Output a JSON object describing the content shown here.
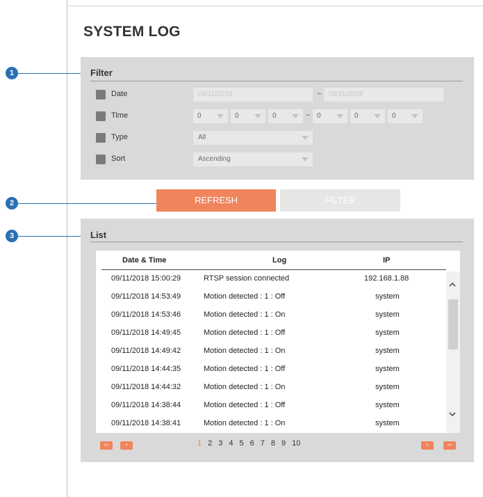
{
  "title": "SYSTEM LOG",
  "callouts": [
    "1",
    "2",
    "3"
  ],
  "filter": {
    "heading": "Filter",
    "date": {
      "label": "Date",
      "from": "09/11/2018",
      "to": "09/11/2018",
      "sep": "~"
    },
    "time": {
      "label": "Time",
      "from": [
        "0",
        "0",
        "0"
      ],
      "to": [
        "0",
        "0",
        "0"
      ],
      "sep": "~"
    },
    "type": {
      "label": "Type",
      "value": "All"
    },
    "sort": {
      "label": "Sort",
      "value": "Ascending"
    }
  },
  "buttons": {
    "refresh": "REFRESH",
    "filter": "FILTER"
  },
  "list": {
    "heading": "List",
    "columns": [
      "Date & Time",
      "Log",
      "IP"
    ],
    "rows": [
      [
        "09/11/2018 15:00:29",
        "RTSP session connected",
        "192.168.1.88"
      ],
      [
        "09/11/2018 14:53:49",
        "Motion detected : 1 : Off",
        "system"
      ],
      [
        "09/11/2018 14:53:46",
        "Motion detected : 1 : On",
        "system"
      ],
      [
        "09/11/2018 14:49:45",
        "Motion detected : 1 : Off",
        "system"
      ],
      [
        "09/11/2018 14:49:42",
        "Motion detected : 1 : On",
        "system"
      ],
      [
        "09/11/2018 14:44:35",
        "Motion detected : 1 : Off",
        "system"
      ],
      [
        "09/11/2018 14:44:32",
        "Motion detected : 1 : On",
        "system"
      ],
      [
        "09/11/2018 14:38:44",
        "Motion detected : 1 : Off",
        "system"
      ],
      [
        "09/11/2018 14:38:41",
        "Motion detected : 1 : On",
        "system"
      ]
    ]
  },
  "pagination": {
    "first": "<<",
    "prev": "<",
    "next": ">",
    "last": ">>",
    "pages": [
      "1",
      "2",
      "3",
      "4",
      "5",
      "6",
      "7",
      "8",
      "9",
      "10"
    ],
    "current_page": "1"
  },
  "colors": {
    "accent": "#f0845c",
    "callout": "#2a6fb5",
    "panel": "#d9d9d9"
  },
  "icons": {
    "scroll_up": "chevron-up-icon",
    "scroll_down": "chevron-down-icon",
    "dropdown": "triangle-down-icon"
  }
}
